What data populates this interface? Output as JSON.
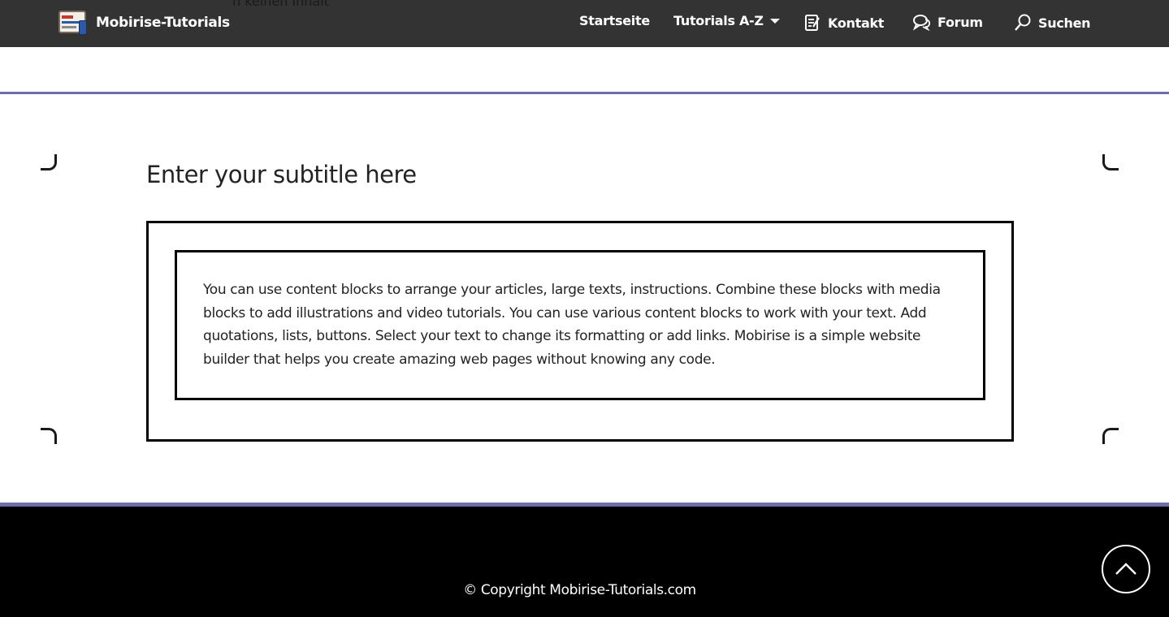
{
  "navbar": {
    "brand_name": "Mobirise-Tutorials",
    "background": "#333333",
    "ghost_text": "n keinen Inhalt",
    "items": [
      {
        "label": "Startseite",
        "icon": ""
      },
      {
        "label": "Tutorials A-Z",
        "icon": "chevron-down-icon"
      },
      {
        "label": "Kontakt",
        "icon": "edit-note-icon"
      },
      {
        "label": "Forum",
        "icon": "chat-bubbles-icon"
      },
      {
        "label": "Suchen",
        "icon": "search-icon"
      }
    ]
  },
  "main": {
    "subtitle": "Enter your subtitle here",
    "body": "You can use content blocks to arrange your articles, large texts, instructions. Combine these blocks with media blocks to add illustrations and video tutorials. You can use various content blocks to work with your text. Add quotations, lists, buttons. Select your text to change its formatting or add links. Mobirise is a simple website builder that helps you create amazing web pages without knowing any code."
  },
  "footer": {
    "copyright": "© Copyright Mobirise-Tutorials.com",
    "scroll_top_icon": "chevron-up-icon"
  },
  "colors": {
    "accent_rule": "#6f6da9",
    "footer_bg": "#000000"
  }
}
